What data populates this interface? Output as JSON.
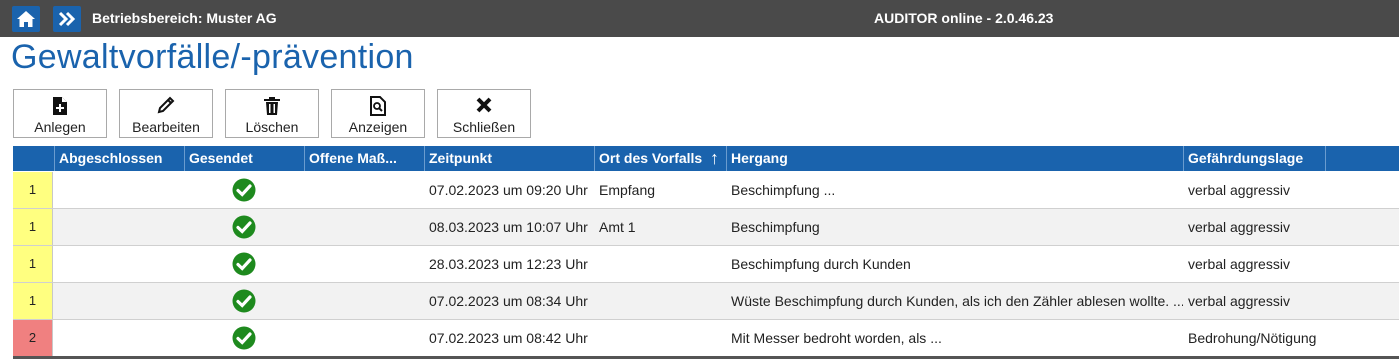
{
  "topbar": {
    "area": "Betriebsbereich: Muster AG",
    "app": "AUDITOR online - 2.0.46.23"
  },
  "page_title": "Gewaltvorfälle/-prävention",
  "toolbar": {
    "new_label": "Anlegen",
    "edit_label": "Bearbeiten",
    "delete_label": "Löschen",
    "view_label": "Anzeigen",
    "close_label": "Schließen"
  },
  "table": {
    "columns": [
      "Abgeschlossen",
      "Gesendet",
      "Offene Maß...",
      "Zeitpunkt",
      "Ort des Vorfalls",
      "Hergang",
      "Gefährdungslage"
    ],
    "sort_indicator": "↑",
    "rows": [
      {
        "level": "1",
        "level_color": "#ffff80",
        "abgeschlossen": "",
        "gesendet": true,
        "offene": "",
        "zeitpunkt": "07.02.2023 um 09:20 Uhr",
        "ort": "Empfang",
        "hergang": "Beschimpfung ...",
        "lage": "verbal aggressiv"
      },
      {
        "level": "1",
        "level_color": "#ffff80",
        "abgeschlossen": "",
        "gesendet": true,
        "offene": "",
        "zeitpunkt": "08.03.2023 um 10:07 Uhr",
        "ort": "Amt 1",
        "hergang": "Beschimpfung",
        "lage": "verbal aggressiv"
      },
      {
        "level": "1",
        "level_color": "#ffff80",
        "abgeschlossen": "",
        "gesendet": true,
        "offene": "",
        "zeitpunkt": "28.03.2023 um 12:23 Uhr",
        "ort": "",
        "hergang": "Beschimpfung durch Kunden",
        "lage": "verbal aggressiv"
      },
      {
        "level": "1",
        "level_color": "#ffff80",
        "abgeschlossen": "",
        "gesendet": true,
        "offene": "",
        "zeitpunkt": "07.02.2023 um 08:34 Uhr",
        "ort": "",
        "hergang": "Wüste Beschimpfung durch Kunden, als ich den Zähler ablesen wollte. ...",
        "lage": "verbal aggressiv"
      },
      {
        "level": "2",
        "level_color": "#f08080",
        "abgeschlossen": "",
        "gesendet": true,
        "offene": "",
        "zeitpunkt": "07.02.2023 um 08:42 Uhr",
        "ort": "",
        "hergang": "Mit Messer bedroht worden, als ...",
        "lage": "Bedrohung/Nötigung"
      }
    ]
  },
  "colors": {
    "accent": "#1a63ad",
    "topbar": "#4a4a4a",
    "check": "#1e8a1e"
  }
}
